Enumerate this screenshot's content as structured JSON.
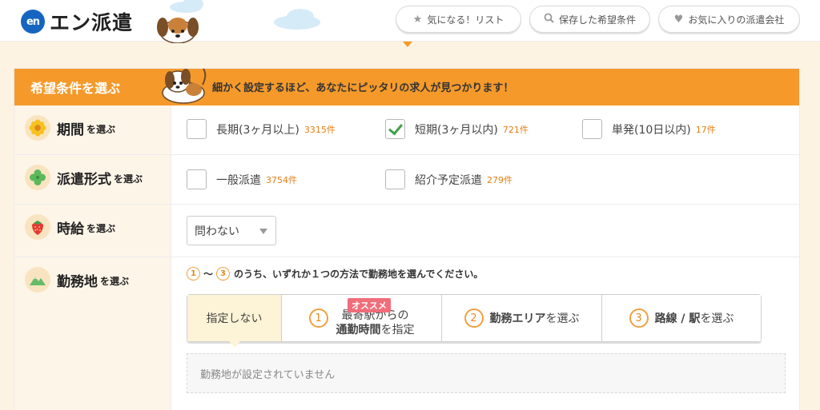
{
  "header": {
    "logo_mark": "en",
    "logo_text": "エン派遣",
    "buttons": [
      {
        "label": "気になる！リスト",
        "icon": "star-icon"
      },
      {
        "label": "保存した希望条件",
        "icon": "search-icon"
      },
      {
        "label": "お気に入りの派遣会社",
        "icon": "heart-icon"
      }
    ]
  },
  "panel": {
    "title": "希望条件を選ぶ",
    "message": "細かく設定するほど、あなたにピッタリの求人が見つかります！"
  },
  "period": {
    "label_main": "期間",
    "label_sub": "を選ぶ",
    "options": [
      {
        "label": "長期(3ヶ月以上)",
        "count": "3315件",
        "checked": false
      },
      {
        "label": "短期(3ヶ月以内)",
        "count": "721件",
        "checked": true
      },
      {
        "label": "単発(10日以内)",
        "count": "17件",
        "checked": false
      }
    ]
  },
  "dispatch": {
    "label_main": "派遣形式",
    "label_sub": "を選ぶ",
    "options": [
      {
        "label": "一般派遣",
        "count": "3754件",
        "checked": false
      },
      {
        "label": "紹介予定派遣",
        "count": "279件",
        "checked": false
      }
    ]
  },
  "wage": {
    "label_main": "時給",
    "label_sub": "を選ぶ",
    "selected": "問わない"
  },
  "location": {
    "label_main": "勤務地",
    "label_sub": "を選ぶ",
    "instruction_n1": "1",
    "instruction_tilde": "〜",
    "instruction_n3": "3",
    "instruction_text": "のうち、いずれか１つの方法で勤務地を選んでください。",
    "tab_none": "指定しない",
    "tab1_num": "1",
    "tab1_badge": "オススメ",
    "tab1_line1": "最寄駅からの",
    "tab1_line2_bold": "通勤時間",
    "tab1_line2_rest": "を指定",
    "tab2_num": "2",
    "tab2_bold": "勤務エリア",
    "tab2_rest": "を選ぶ",
    "tab3_num": "3",
    "tab3_bold": "路線 / 駅",
    "tab3_rest": "を選ぶ",
    "empty_text": "勤務地が設定されていません"
  },
  "colors": {
    "accent": "#f59a2a",
    "count": "#e57e12",
    "check": "#43a047",
    "badge": "#f06d7a"
  }
}
